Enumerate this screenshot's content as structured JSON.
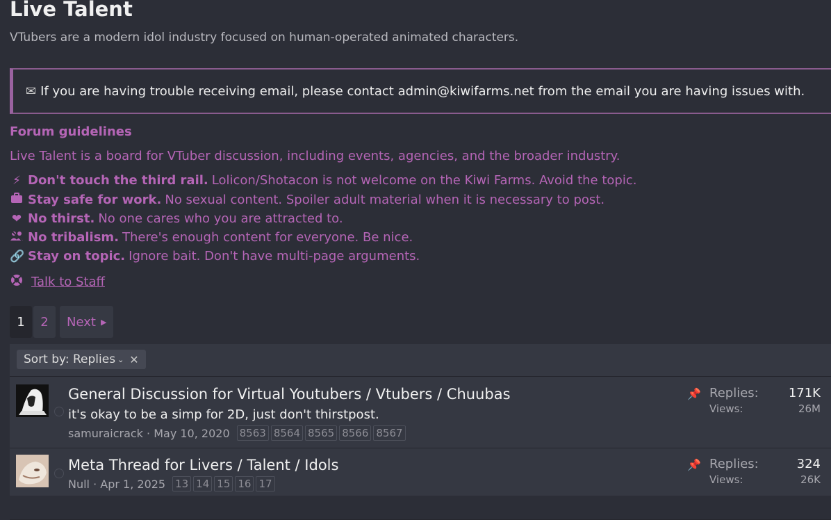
{
  "forum": {
    "title": "Live Talent",
    "description": "VTubers are a modern idol industry focused on human-operated animated characters."
  },
  "notice": {
    "text": "If you are having trouble receiving email, please contact admin@kiwifarms.net from the email you are having issues with."
  },
  "guidelines": {
    "title": "Forum guidelines",
    "intro": "Live Talent is a board for VTuber discussion, including events, agencies, and the broader industry.",
    "rules": [
      {
        "icon": "bolt-icon",
        "bold": "Don't touch the third rail.",
        "text": "Lolicon/Shotacon is not welcome on the Kiwi Farms. Avoid the topic."
      },
      {
        "icon": "briefcase-icon",
        "bold": "Stay safe for work.",
        "text": "No sexual content. Spoiler adult material when it is necessary to post."
      },
      {
        "icon": "broken-heart-icon",
        "bold": "No thirst.",
        "text": "No one cares who you are attracted to."
      },
      {
        "icon": "users-slash-icon",
        "bold": "No tribalism.",
        "text": "There's enough content for everyone. Be nice."
      },
      {
        "icon": "link-icon",
        "bold": "Stay on topic.",
        "text": "Ignore bait. Don't have multi-page arguments."
      }
    ],
    "staff_link": "Talk to Staff"
  },
  "pagination": {
    "pages": [
      "1",
      "2"
    ],
    "current": "1",
    "next_label": "Next"
  },
  "sort": {
    "label": "Sort by: Replies"
  },
  "threads": [
    {
      "title": "General Discussion for Virtual Youtubers / Vtubers / Chuubas",
      "snippet": "it's okay to be a simp for 2D, just don't thirstpost.",
      "author": "samuraicrack",
      "date": "May 10, 2020",
      "pages": [
        "8563",
        "8564",
        "8565",
        "8566",
        "8567"
      ],
      "replies_label": "Replies:",
      "replies": "171K",
      "views_label": "Views:",
      "views": "26M",
      "sticky": true
    },
    {
      "title": "Meta Thread for Livers / Talent / Idols",
      "snippet": "",
      "author": "Null",
      "date": "Apr 1, 2025",
      "pages": [
        "13",
        "14",
        "15",
        "16",
        "17"
      ],
      "replies_label": "Replies:",
      "replies": "324",
      "views_label": "Views:",
      "views": "26K",
      "sticky": true
    }
  ],
  "colors": {
    "background": "#2c2e37",
    "accent": "#b565b6",
    "panel": "#353842"
  }
}
